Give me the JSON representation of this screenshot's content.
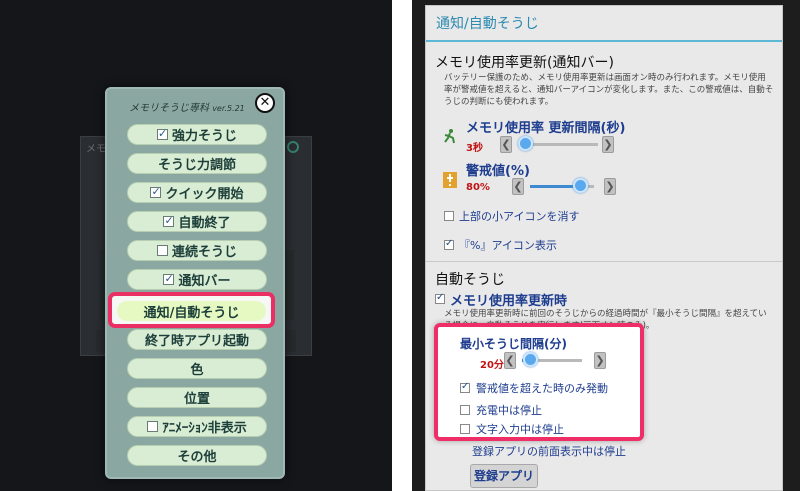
{
  "left": {
    "ghost_title": "メモ",
    "menu": {
      "title": "メモリそうじ専科",
      "version": "ver.5.21",
      "close_symbol": "✕",
      "items": [
        {
          "label": "強力そうじ",
          "checkbox": true,
          "checked": true
        },
        {
          "label": "そうじ力調節",
          "checkbox": false,
          "checked": false
        },
        {
          "label": "クイック開始",
          "checkbox": true,
          "checked": true
        },
        {
          "label": "自動終了",
          "checkbox": true,
          "checked": true
        },
        {
          "label": "連続そうじ",
          "checkbox": true,
          "checked": false
        },
        {
          "label": "通知バー",
          "checkbox": true,
          "checked": true
        },
        {
          "label": "通知/自動そうじ",
          "checkbox": false,
          "checked": false
        },
        {
          "label": "終了時アプリ起動",
          "checkbox": false,
          "checked": false
        },
        {
          "label": "色",
          "checkbox": false,
          "checked": false
        },
        {
          "label": "位置",
          "checkbox": false,
          "checked": false
        },
        {
          "label": "ｱﾆﾒｰｼｮﾝ非表示",
          "checkbox": true,
          "checked": false
        },
        {
          "label": "その他",
          "checkbox": false,
          "checked": false
        }
      ]
    }
  },
  "right": {
    "title": "通知/自動そうじ",
    "section1": {
      "head": "メモリ使用率更新(通知バー)",
      "desc": "バッテリー保護のため、メモリ使用率更新は画面オン時のみ行われます。メモリ使用率が警戒値を超えると、通知バーアイコンが変化します。また、この警戒値は、自動そうじの判断にも使われます。",
      "interval_label": "メモリ使用率 更新間隔(秒)",
      "interval_value": "3秒",
      "interval_fraction": 0.1,
      "warn_label": "警戒値(%)",
      "warn_value": "80%",
      "warn_fraction": 0.8,
      "hide_small_icon": "上部の小アイコンを消す",
      "hide_small_icon_checked": false,
      "show_percent_icon": "『%』アイコン表示",
      "show_percent_icon_checked": true
    },
    "section2": {
      "head": "自動そうじ",
      "on_update_label": "メモリ使用率更新時",
      "on_update_checked": true,
      "desc": "メモリ使用率更新時に前回のそうじからの経過時間が『最小そうじ間隔』を超えている場合に、自動そうじを実行します(画面オン時のみ)。",
      "min_interval_label": "最小そうじ間隔(分)",
      "min_interval_value": "20分",
      "min_interval_fraction": 0.15,
      "only_over_warn": "警戒値を超えた時のみ発動",
      "only_over_warn_checked": true,
      "stop_charging": "充電中は停止",
      "stop_charging_checked": false,
      "stop_text_input": "文字入力中は停止",
      "stop_text_input_checked": false,
      "stop_registered_front": "登録アプリの前面表示中は停止",
      "register_button": "登録アプリ"
    },
    "chevron_left": "❮",
    "chevron_right": "❯"
  },
  "colors": {
    "highlight": "#ea2f65",
    "accent_blue": "#2d8bb0",
    "menu_bg": "#8ba7a1",
    "value_red": "#c21414"
  }
}
